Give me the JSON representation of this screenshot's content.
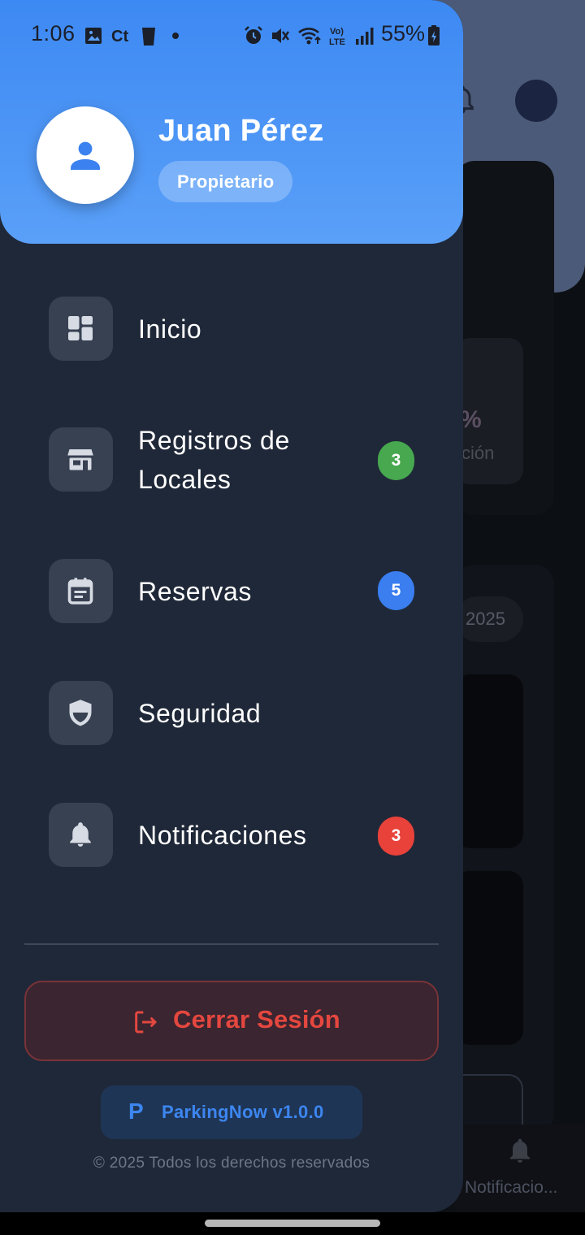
{
  "status_bar": {
    "time": "1:06",
    "battery_percent": "55%",
    "icons": [
      "gallery-icon",
      "ct-icon",
      "trash-icon",
      "dot-icon",
      "alarm-icon",
      "mute-icon",
      "wifi-icon",
      "volte-icon",
      "signal-icon",
      "battery-charging-icon"
    ]
  },
  "user": {
    "name": "Juan Pérez",
    "role": "Propietario"
  },
  "menu": {
    "items": [
      {
        "label": "Inicio",
        "icon": "dashboard-icon",
        "badge": null
      },
      {
        "label": "Registros de Locales",
        "icon": "store-icon",
        "badge": "3",
        "badge_color": "#47a84f"
      },
      {
        "label": "Reservas",
        "icon": "calendar-icon",
        "badge": "5",
        "badge_color": "#3a7ef0"
      },
      {
        "label": "Seguridad",
        "icon": "shield-icon",
        "badge": null
      },
      {
        "label": "Notificaciones",
        "icon": "bell-icon",
        "badge": "3",
        "badge_color": "#e8423b"
      }
    ]
  },
  "logout": {
    "label": "Cerrar Sesión",
    "icon": "logout-icon"
  },
  "app": {
    "version_label": "ParkingNow v1.0.0",
    "logo_letter": "P",
    "copyright": "© 2025 Todos los derechos reservados"
  },
  "background": {
    "stat_suffix": "%",
    "stat_caption": "ción",
    "year_chip": "2025",
    "bottom_nav_label": "Notificacio..."
  },
  "colors": {
    "accent": "#3d89f3",
    "drawer_bg": "#1f2838",
    "danger": "#e4473f"
  }
}
